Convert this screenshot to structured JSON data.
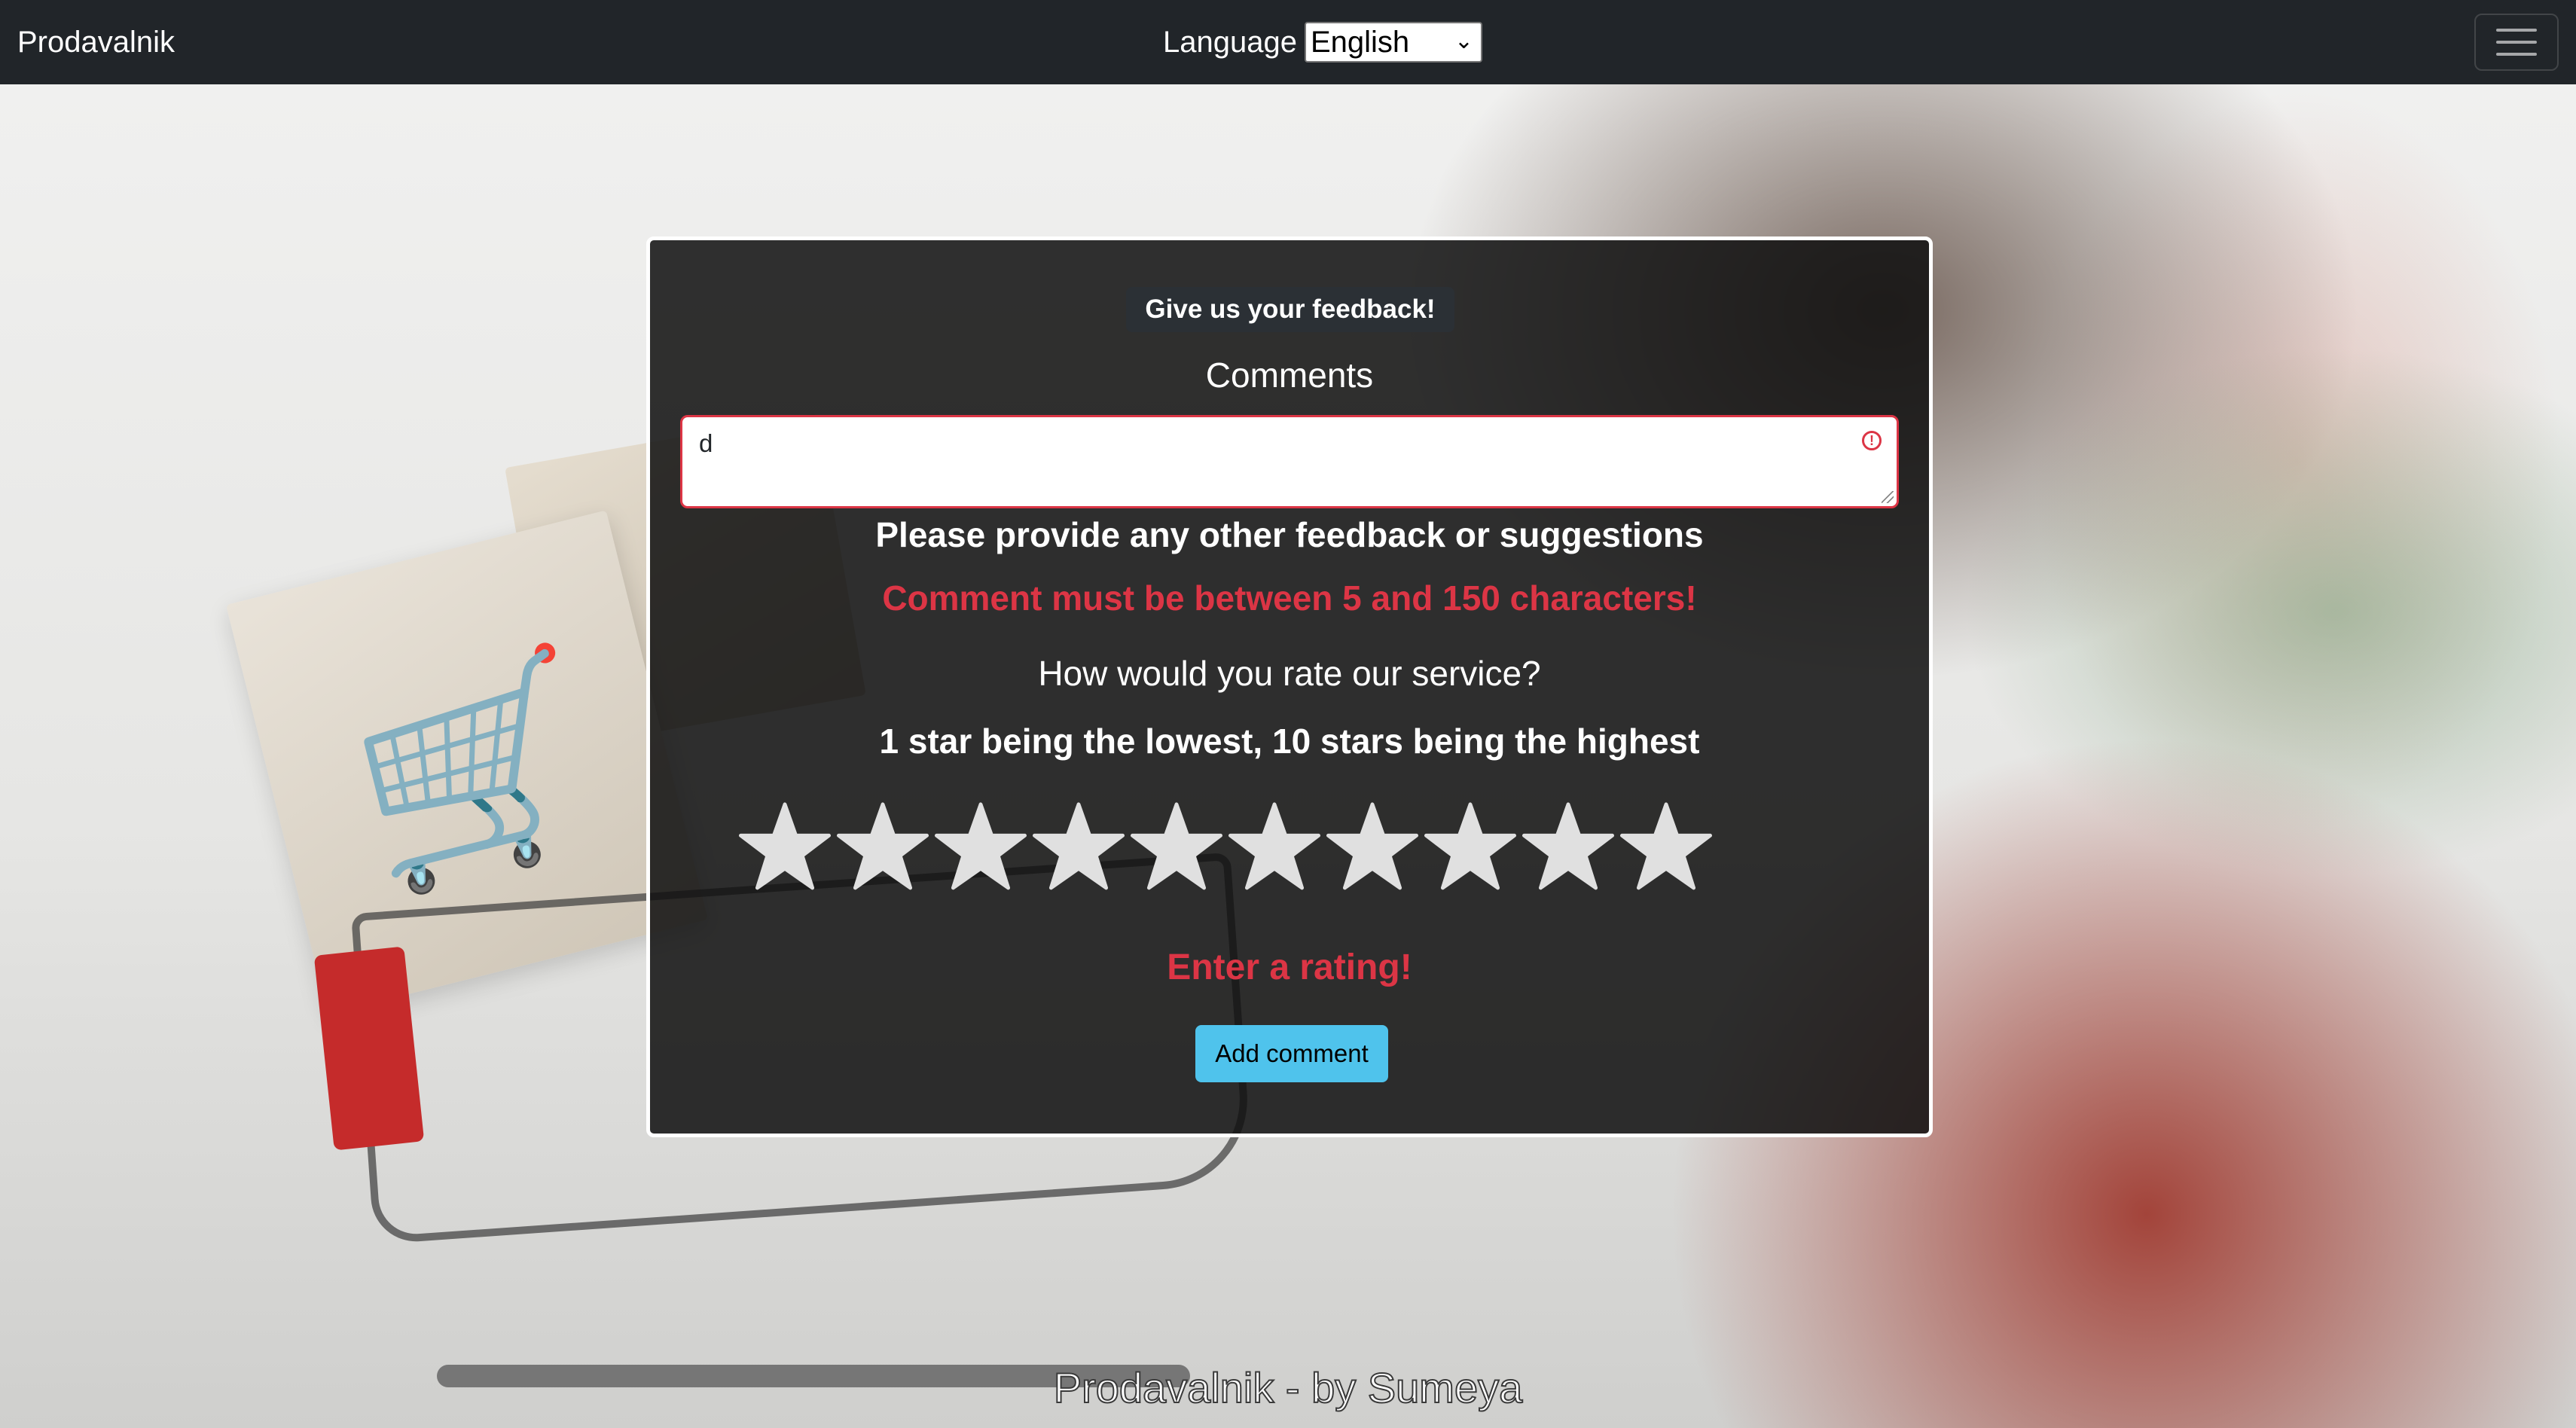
{
  "navbar": {
    "brand": "Prodavalnik",
    "language_label": "Language",
    "language_selected": "English"
  },
  "feedback": {
    "badge": "Give us your feedback!",
    "comments_label": "Comments",
    "comment_value": "d",
    "hint": "Please provide any other feedback or suggestions",
    "comment_error": "Comment must be between 5 and 150 characters!",
    "rating_question": "How would you rate our service?",
    "rating_scale": "1 star being the lowest, 10 stars being the highest",
    "rating": {
      "max": 10,
      "selected": 0
    },
    "rating_error": "Enter a rating!",
    "submit_label": "Add comment"
  },
  "footer": {
    "text": "Prodavalnik - by Sumeya"
  },
  "colors": {
    "navbar_bg": "#212529",
    "error": "#dc3545",
    "button": "#4fc3ec",
    "star": "#e0e0e0"
  },
  "icons": {
    "menu": "hamburger-icon",
    "input_error": "exclamation-circle-icon",
    "rating": "star-icon"
  }
}
